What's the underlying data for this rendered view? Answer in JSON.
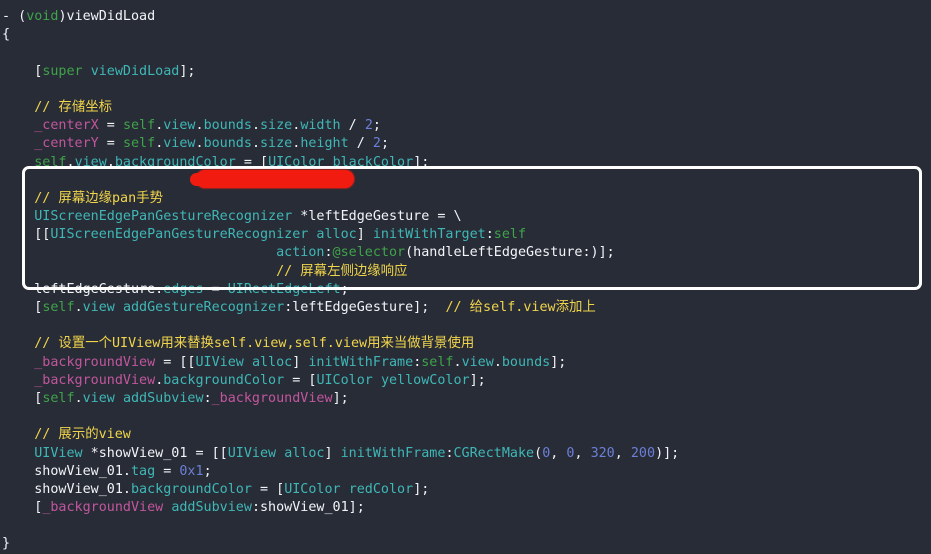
{
  "editor": {
    "background_color": "#282c36",
    "language": "Objective-C",
    "colors": {
      "plain": "#f2f4f8",
      "comment": "#f0d44c",
      "keyword": "#3fa34a",
      "type": "#3fb7b7",
      "ivar": "#c2569e",
      "number": "#6c7fd8",
      "highlight_border": "#ffffff",
      "redaction": "#f21b10"
    }
  },
  "annotations": {
    "highlight_box": {
      "label": "highlighted code region"
    },
    "redaction_mark": {
      "label": "red marker redaction over comment text"
    }
  },
  "code": {
    "lines": [
      {
        "id": "l1",
        "tokens": [
          {
            "c": "t-plain",
            "s": "- "
          },
          {
            "c": "t-punct",
            "s": "("
          },
          {
            "c": "t-kw",
            "s": "void"
          },
          {
            "c": "t-punct",
            "s": ")"
          },
          {
            "c": "t-plain",
            "s": "viewDidLoad"
          }
        ]
      },
      {
        "id": "l2",
        "tokens": [
          {
            "c": "t-plain",
            "s": "{"
          }
        ]
      },
      {
        "id": "l3",
        "tokens": [
          {
            "c": "t-plain",
            "s": ""
          }
        ]
      },
      {
        "id": "l4",
        "tokens": [
          {
            "c": "t-plain",
            "s": "    ["
          },
          {
            "c": "t-kw",
            "s": "super"
          },
          {
            "c": "t-plain",
            "s": " "
          },
          {
            "c": "t-type",
            "s": "viewDidLoad"
          },
          {
            "c": "t-plain",
            "s": "];"
          }
        ]
      },
      {
        "id": "l5",
        "tokens": [
          {
            "c": "t-plain",
            "s": ""
          }
        ]
      },
      {
        "id": "l6",
        "tokens": [
          {
            "c": "t-comment",
            "s": "    // 存储坐标"
          }
        ]
      },
      {
        "id": "l7",
        "tokens": [
          {
            "c": "t-plain",
            "s": "    "
          },
          {
            "c": "t-ivar",
            "s": "_centerX"
          },
          {
            "c": "t-plain",
            "s": " = "
          },
          {
            "c": "t-self",
            "s": "self"
          },
          {
            "c": "t-plain",
            "s": "."
          },
          {
            "c": "t-type",
            "s": "view"
          },
          {
            "c": "t-plain",
            "s": "."
          },
          {
            "c": "t-type",
            "s": "bounds"
          },
          {
            "c": "t-plain",
            "s": "."
          },
          {
            "c": "t-type",
            "s": "size"
          },
          {
            "c": "t-plain",
            "s": "."
          },
          {
            "c": "t-type",
            "s": "width"
          },
          {
            "c": "t-plain",
            "s": " / "
          },
          {
            "c": "t-num",
            "s": "2"
          },
          {
            "c": "t-plain",
            "s": ";"
          }
        ]
      },
      {
        "id": "l8",
        "tokens": [
          {
            "c": "t-plain",
            "s": "    "
          },
          {
            "c": "t-ivar",
            "s": "_centerY"
          },
          {
            "c": "t-plain",
            "s": " = "
          },
          {
            "c": "t-self",
            "s": "self"
          },
          {
            "c": "t-plain",
            "s": "."
          },
          {
            "c": "t-type",
            "s": "view"
          },
          {
            "c": "t-plain",
            "s": "."
          },
          {
            "c": "t-type",
            "s": "bounds"
          },
          {
            "c": "t-plain",
            "s": "."
          },
          {
            "c": "t-type",
            "s": "size"
          },
          {
            "c": "t-plain",
            "s": "."
          },
          {
            "c": "t-type",
            "s": "height"
          },
          {
            "c": "t-plain",
            "s": " / "
          },
          {
            "c": "t-num",
            "s": "2"
          },
          {
            "c": "t-plain",
            "s": ";"
          }
        ]
      },
      {
        "id": "l9",
        "tokens": [
          {
            "c": "t-plain",
            "s": "    "
          },
          {
            "c": "t-self",
            "s": "self"
          },
          {
            "c": "t-plain",
            "s": "."
          },
          {
            "c": "t-type",
            "s": "view"
          },
          {
            "c": "t-plain",
            "s": "."
          },
          {
            "c": "t-type",
            "s": "backgroundColor"
          },
          {
            "c": "t-plain",
            "s": " = ["
          },
          {
            "c": "t-type",
            "s": "UIColor"
          },
          {
            "c": "t-plain",
            "s": " "
          },
          {
            "c": "t-type",
            "s": "blackColor"
          },
          {
            "c": "t-plain",
            "s": "];"
          }
        ]
      },
      {
        "id": "l10",
        "tokens": [
          {
            "c": "t-plain",
            "s": ""
          }
        ]
      },
      {
        "id": "l11",
        "tokens": [
          {
            "c": "t-comment",
            "s": "    // 屏幕边缘pan手势 "
          }
        ]
      },
      {
        "id": "l12",
        "tokens": [
          {
            "c": "t-plain",
            "s": "    "
          },
          {
            "c": "t-type",
            "s": "UIScreenEdgePanGestureRecognizer"
          },
          {
            "c": "t-plain",
            "s": " *leftEdgeGesture = \\"
          }
        ]
      },
      {
        "id": "l13",
        "tokens": [
          {
            "c": "t-plain",
            "s": "    [["
          },
          {
            "c": "t-type",
            "s": "UIScreenEdgePanGestureRecognizer"
          },
          {
            "c": "t-plain",
            "s": " "
          },
          {
            "c": "t-type",
            "s": "alloc"
          },
          {
            "c": "t-plain",
            "s": "] "
          },
          {
            "c": "t-type",
            "s": "initWithTarget"
          },
          {
            "c": "t-plain",
            "s": ":"
          },
          {
            "c": "t-self",
            "s": "self"
          }
        ]
      },
      {
        "id": "l14",
        "tokens": [
          {
            "c": "t-plain",
            "s": "                                  "
          },
          {
            "c": "t-type",
            "s": "action"
          },
          {
            "c": "t-plain",
            "s": ":"
          },
          {
            "c": "t-kw",
            "s": "@selector"
          },
          {
            "c": "t-plain",
            "s": "(handleLeftEdgeGesture:)];"
          }
        ]
      },
      {
        "id": "l15",
        "tokens": [
          {
            "c": "t-plain",
            "s": "                                  "
          },
          {
            "c": "t-comment",
            "s": "// 屏幕左侧边缘响应"
          }
        ]
      },
      {
        "id": "l16",
        "tokens": [
          {
            "c": "t-plain",
            "s": "    leftEdgeGesture."
          },
          {
            "c": "t-type",
            "s": "edges"
          },
          {
            "c": "t-plain",
            "s": " = "
          },
          {
            "c": "t-type",
            "s": "UIRectEdgeLeft"
          },
          {
            "c": "t-plain",
            "s": ";"
          }
        ]
      },
      {
        "id": "l17",
        "tokens": [
          {
            "c": "t-plain",
            "s": "    ["
          },
          {
            "c": "t-self",
            "s": "self"
          },
          {
            "c": "t-plain",
            "s": "."
          },
          {
            "c": "t-type",
            "s": "view"
          },
          {
            "c": "t-plain",
            "s": " "
          },
          {
            "c": "t-type",
            "s": "addGestureRecognizer"
          },
          {
            "c": "t-plain",
            "s": ":leftEdgeGesture];  "
          },
          {
            "c": "t-comment",
            "s": "// 给self.view添加上"
          }
        ]
      },
      {
        "id": "l18",
        "tokens": [
          {
            "c": "t-plain",
            "s": ""
          }
        ]
      },
      {
        "id": "l19",
        "tokens": [
          {
            "c": "t-comment",
            "s": "    // 设置一个UIView用来替换self.view,self.view用来当做背景使用"
          }
        ]
      },
      {
        "id": "l20",
        "tokens": [
          {
            "c": "t-plain",
            "s": "    "
          },
          {
            "c": "t-ivar",
            "s": "_backgroundView"
          },
          {
            "c": "t-plain",
            "s": " = [["
          },
          {
            "c": "t-type",
            "s": "UIView"
          },
          {
            "c": "t-plain",
            "s": " "
          },
          {
            "c": "t-type",
            "s": "alloc"
          },
          {
            "c": "t-plain",
            "s": "] "
          },
          {
            "c": "t-type",
            "s": "initWithFrame"
          },
          {
            "c": "t-plain",
            "s": ":"
          },
          {
            "c": "t-self",
            "s": "self"
          },
          {
            "c": "t-plain",
            "s": "."
          },
          {
            "c": "t-type",
            "s": "view"
          },
          {
            "c": "t-plain",
            "s": "."
          },
          {
            "c": "t-type",
            "s": "bounds"
          },
          {
            "c": "t-plain",
            "s": "];"
          }
        ]
      },
      {
        "id": "l21",
        "tokens": [
          {
            "c": "t-plain",
            "s": "    "
          },
          {
            "c": "t-ivar",
            "s": "_backgroundView"
          },
          {
            "c": "t-plain",
            "s": "."
          },
          {
            "c": "t-type",
            "s": "backgroundColor"
          },
          {
            "c": "t-plain",
            "s": " = ["
          },
          {
            "c": "t-type",
            "s": "UIColor"
          },
          {
            "c": "t-plain",
            "s": " "
          },
          {
            "c": "t-type",
            "s": "yellowColor"
          },
          {
            "c": "t-plain",
            "s": "];"
          }
        ]
      },
      {
        "id": "l22",
        "tokens": [
          {
            "c": "t-plain",
            "s": "    ["
          },
          {
            "c": "t-self",
            "s": "self"
          },
          {
            "c": "t-plain",
            "s": "."
          },
          {
            "c": "t-type",
            "s": "view"
          },
          {
            "c": "t-plain",
            "s": " "
          },
          {
            "c": "t-type",
            "s": "addSubview"
          },
          {
            "c": "t-plain",
            "s": ":"
          },
          {
            "c": "t-ivar",
            "s": "_backgroundView"
          },
          {
            "c": "t-plain",
            "s": "];"
          }
        ]
      },
      {
        "id": "l23",
        "tokens": [
          {
            "c": "t-plain",
            "s": ""
          }
        ]
      },
      {
        "id": "l24",
        "tokens": [
          {
            "c": "t-comment",
            "s": "    // 展示的view"
          }
        ]
      },
      {
        "id": "l25",
        "tokens": [
          {
            "c": "t-plain",
            "s": "    "
          },
          {
            "c": "t-type",
            "s": "UIView"
          },
          {
            "c": "t-plain",
            "s": " *showView_01 = [["
          },
          {
            "c": "t-type",
            "s": "UIView"
          },
          {
            "c": "t-plain",
            "s": " "
          },
          {
            "c": "t-type",
            "s": "alloc"
          },
          {
            "c": "t-plain",
            "s": "] "
          },
          {
            "c": "t-type",
            "s": "initWithFrame"
          },
          {
            "c": "t-plain",
            "s": ":"
          },
          {
            "c": "t-type",
            "s": "CGRectMake"
          },
          {
            "c": "t-plain",
            "s": "("
          },
          {
            "c": "t-num",
            "s": "0"
          },
          {
            "c": "t-plain",
            "s": ", "
          },
          {
            "c": "t-num",
            "s": "0"
          },
          {
            "c": "t-plain",
            "s": ", "
          },
          {
            "c": "t-num",
            "s": "320"
          },
          {
            "c": "t-plain",
            "s": ", "
          },
          {
            "c": "t-num",
            "s": "200"
          },
          {
            "c": "t-plain",
            "s": ")];"
          }
        ]
      },
      {
        "id": "l26",
        "tokens": [
          {
            "c": "t-plain",
            "s": "    showView_01."
          },
          {
            "c": "t-type",
            "s": "tag"
          },
          {
            "c": "t-plain",
            "s": " = "
          },
          {
            "c": "t-num",
            "s": "0x1"
          },
          {
            "c": "t-plain",
            "s": ";"
          }
        ]
      },
      {
        "id": "l27",
        "tokens": [
          {
            "c": "t-plain",
            "s": "    showView_01."
          },
          {
            "c": "t-type",
            "s": "backgroundColor"
          },
          {
            "c": "t-plain",
            "s": " = ["
          },
          {
            "c": "t-type",
            "s": "UIColor"
          },
          {
            "c": "t-plain",
            "s": " "
          },
          {
            "c": "t-type",
            "s": "redColor"
          },
          {
            "c": "t-plain",
            "s": "];"
          }
        ]
      },
      {
        "id": "l28",
        "tokens": [
          {
            "c": "t-plain",
            "s": "    ["
          },
          {
            "c": "t-ivar",
            "s": "_backgroundView"
          },
          {
            "c": "t-plain",
            "s": " "
          },
          {
            "c": "t-type",
            "s": "addSubview"
          },
          {
            "c": "t-plain",
            "s": ":showView_01];"
          }
        ]
      },
      {
        "id": "l29",
        "tokens": [
          {
            "c": "t-plain",
            "s": ""
          }
        ]
      },
      {
        "id": "l30",
        "tokens": [
          {
            "c": "t-plain",
            "s": "}"
          }
        ]
      }
    ]
  }
}
